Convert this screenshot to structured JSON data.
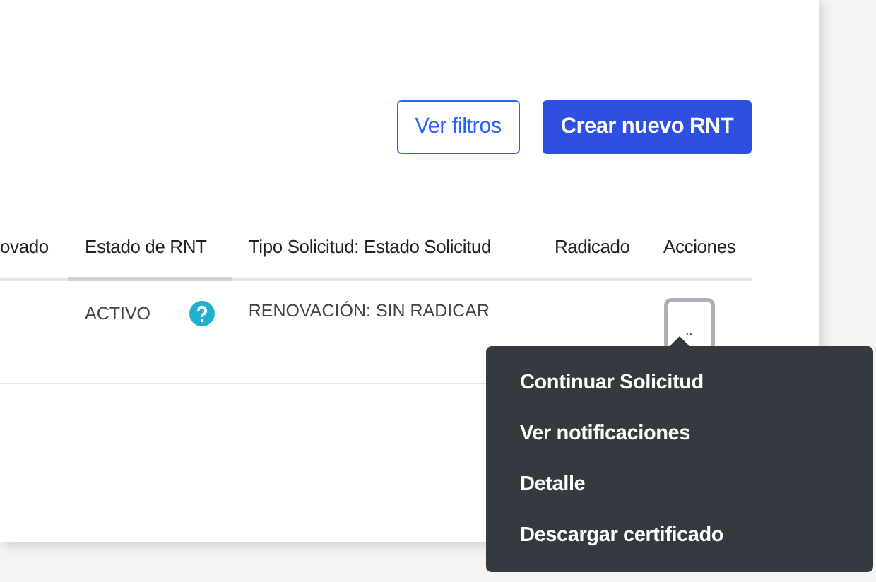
{
  "toolbar": {
    "buttons": [
      {
        "label": "Ver filtros",
        "kind": "outline"
      },
      {
        "label": "Crear nuevo RNT",
        "kind": "primary"
      }
    ]
  },
  "table": {
    "columns": [
      {
        "label": "ovado",
        "sorted": false
      },
      {
        "label": "Estado de RNT",
        "sorted": true
      },
      {
        "label": "Tipo Solicitud: Estado Solicitud",
        "sorted": false
      },
      {
        "label": "Radicado",
        "sorted": false
      },
      {
        "label": "Acciones",
        "sorted": false
      }
    ],
    "rows": [
      {
        "cells": [
          "",
          "ACTIVO",
          "RENOVACIÓN: SIN RADICAR",
          ""
        ],
        "actions_label": ".."
      }
    ]
  },
  "menu": {
    "items": [
      {
        "label": "Continuar Solicitud"
      },
      {
        "label": "Ver notificaciones"
      },
      {
        "label": "Detalle"
      },
      {
        "label": "Descargar certificado"
      }
    ]
  }
}
